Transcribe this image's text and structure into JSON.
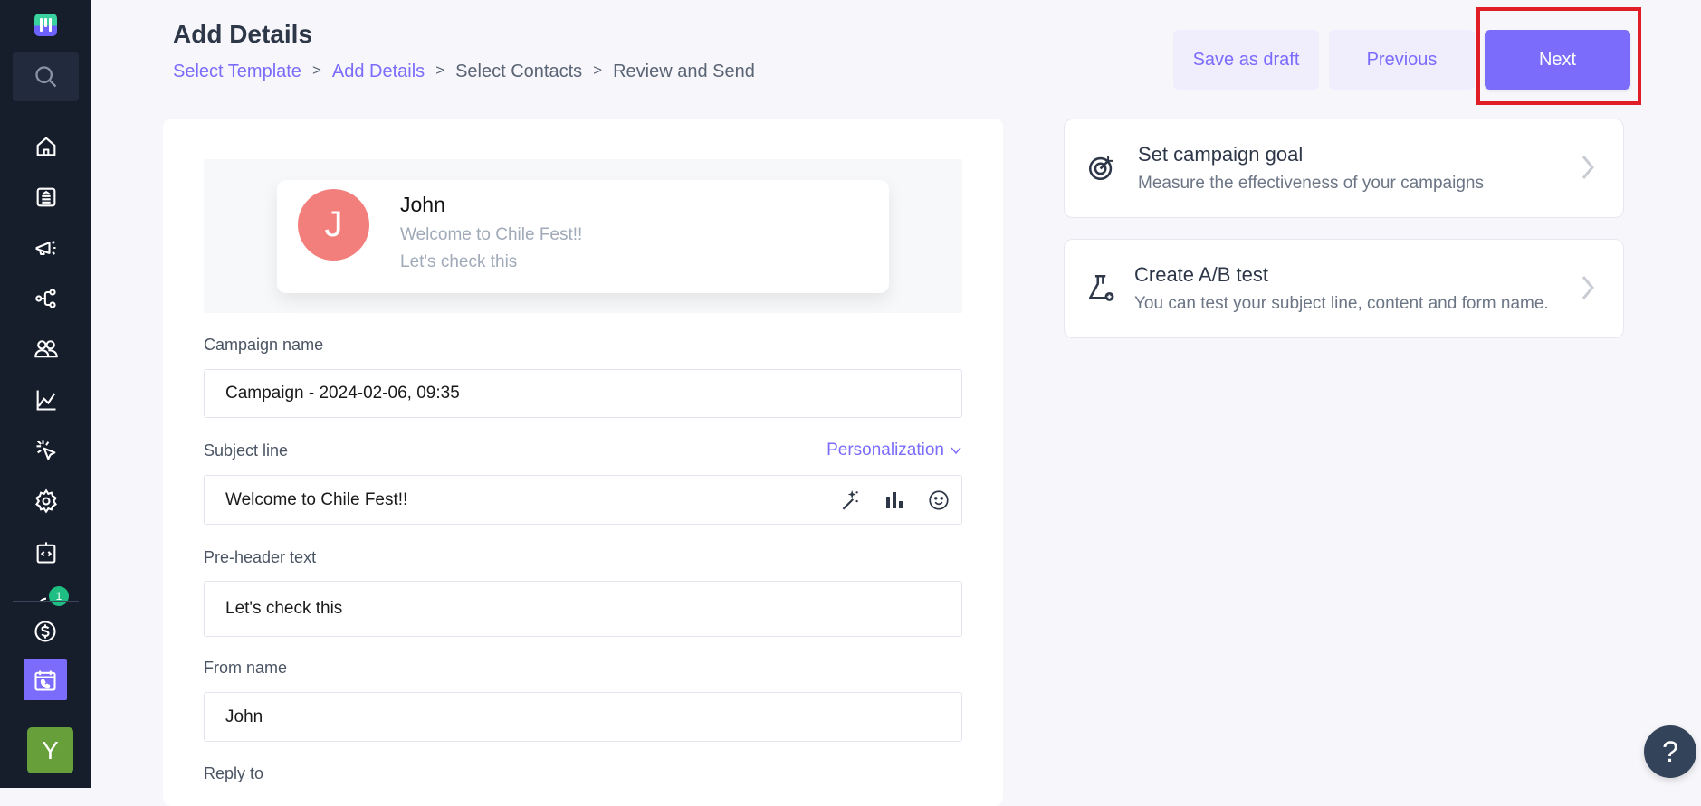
{
  "sidebar": {
    "logo": "app-logo",
    "search_icon": "search-icon",
    "nav_items": [
      {
        "name": "home",
        "icon": "home-icon"
      },
      {
        "name": "templates",
        "icon": "template-icon"
      },
      {
        "name": "campaigns",
        "icon": "megaphone-icon"
      },
      {
        "name": "automations",
        "icon": "workflow-icon"
      },
      {
        "name": "contacts",
        "icon": "users-icon"
      },
      {
        "name": "reports",
        "icon": "chart-line-icon"
      },
      {
        "name": "tracking",
        "icon": "cursor-click-icon"
      },
      {
        "name": "settings",
        "icon": "gear-icon"
      },
      {
        "name": "integrations",
        "icon": "code-clipboard-icon"
      },
      {
        "name": "notifications",
        "icon": "notification-icon",
        "badge": "1"
      }
    ],
    "billing_icon": "dollar-icon",
    "meetings_icon": "calendar-phone-icon",
    "user_initial": "Y"
  },
  "header": {
    "title": "Add Details",
    "breadcrumb": [
      {
        "label": "Select Template",
        "state": "active"
      },
      {
        "label": "Add Details",
        "state": "active"
      },
      {
        "label": "Select Contacts",
        "state": "inactive"
      },
      {
        "label": "Review and Send",
        "state": "inactive"
      }
    ],
    "separator": ">",
    "buttons": {
      "save_draft": "Save as draft",
      "previous": "Previous",
      "next": "Next"
    }
  },
  "preview": {
    "avatar_initial": "J",
    "sender": "John",
    "subject": "Welcome to Chile Fest!!",
    "preheader": "Let's check this"
  },
  "form": {
    "campaign_name": {
      "label": "Campaign name",
      "value": "Campaign - 2024-02-06, 09:35"
    },
    "subject_line": {
      "label": "Subject line",
      "value": "Welcome to Chile Fest!!",
      "personalization": "Personalization"
    },
    "preheader": {
      "label": "Pre-header text",
      "value": "Let's check this"
    },
    "from_name": {
      "label": "From name",
      "value": "John"
    },
    "reply_to": {
      "label": "Reply to"
    }
  },
  "right_panel": [
    {
      "title": "Set campaign goal",
      "subtitle": "Measure the effectiveness of your campaigns",
      "icon": "target-icon"
    },
    {
      "title": "Create A/B test",
      "subtitle": "You can test your subject line, content and form name.",
      "icon": "flask-icon"
    }
  ],
  "help": {
    "label": "?"
  },
  "colors": {
    "accent": "#7b6cfb",
    "sidebar_bg": "#161d2b",
    "highlight": "#e01e28",
    "avatar_j": "#f37f7d",
    "avatar_y": "#67a03a",
    "badge": "#1fbf83"
  }
}
